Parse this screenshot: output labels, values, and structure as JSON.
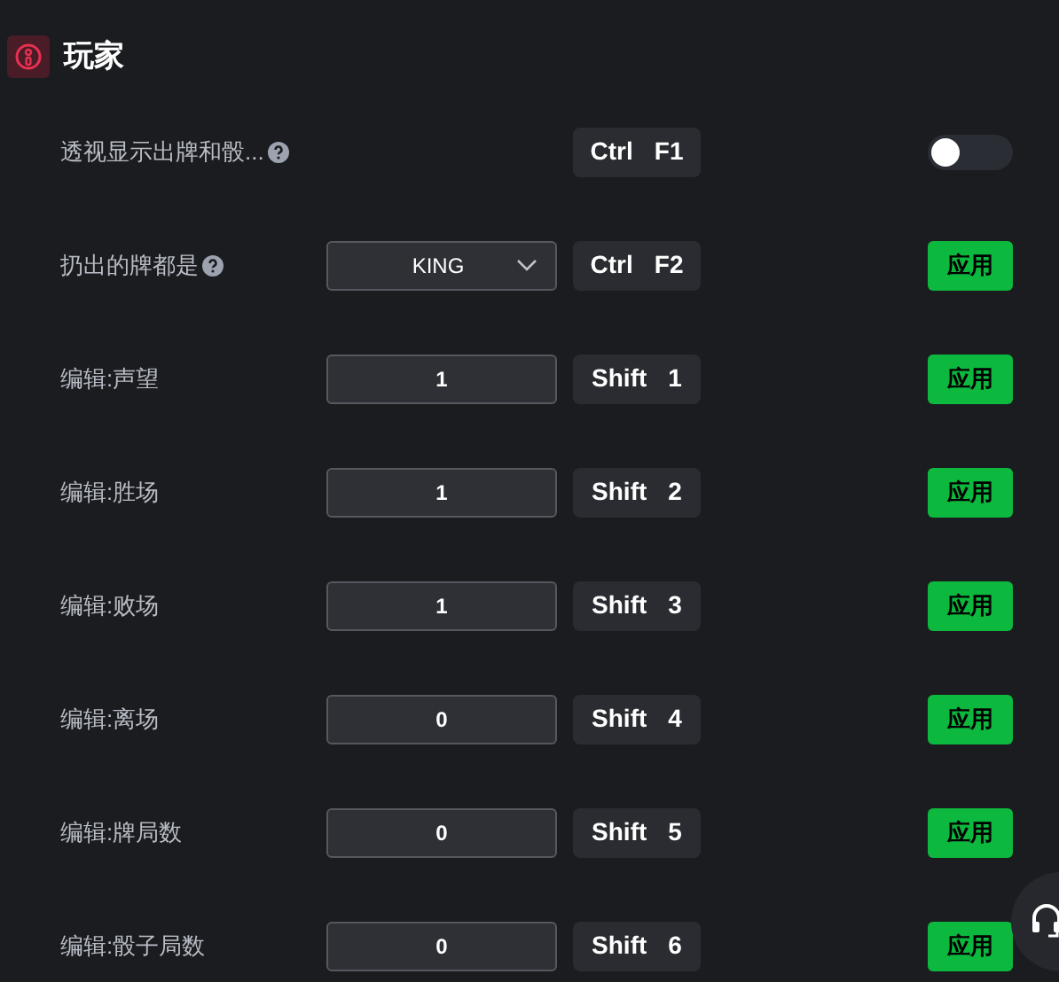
{
  "section": {
    "title": "玩家"
  },
  "rows": [
    {
      "kind": "toggle",
      "label": "透视显示出牌和骰...",
      "help": true,
      "keys": [
        "Ctrl",
        "F1"
      ],
      "on": false
    },
    {
      "kind": "select",
      "label": "扔出的牌都是",
      "help": true,
      "value": "KING",
      "keys": [
        "Ctrl",
        "F2"
      ],
      "button": "应用"
    },
    {
      "kind": "number",
      "label": "编辑:声望",
      "help": false,
      "value": "1",
      "keys": [
        "Shift",
        "1"
      ],
      "button": "应用"
    },
    {
      "kind": "number",
      "label": "编辑:胜场",
      "help": false,
      "value": "1",
      "keys": [
        "Shift",
        "2"
      ],
      "button": "应用"
    },
    {
      "kind": "number",
      "label": "编辑:败场",
      "help": false,
      "value": "1",
      "keys": [
        "Shift",
        "3"
      ],
      "button": "应用"
    },
    {
      "kind": "number",
      "label": "编辑:离场",
      "help": false,
      "value": "0",
      "keys": [
        "Shift",
        "4"
      ],
      "button": "应用"
    },
    {
      "kind": "number",
      "label": "编辑:牌局数",
      "help": false,
      "value": "0",
      "keys": [
        "Shift",
        "5"
      ],
      "button": "应用"
    },
    {
      "kind": "number",
      "label": "编辑:骰子局数",
      "help": false,
      "value": "0",
      "keys": [
        "Shift",
        "6"
      ],
      "button": "应用"
    }
  ]
}
